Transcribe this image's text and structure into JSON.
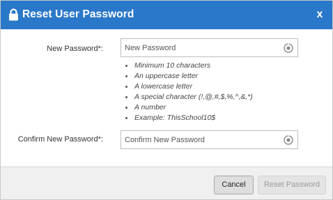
{
  "dialog": {
    "title": "Reset User Password",
    "close_label": "x",
    "header_color": "#2a78c9",
    "title_icon": "lock-icon"
  },
  "form": {
    "new_password": {
      "label": "New Password*:",
      "placeholder": "New Password",
      "value": "",
      "icon": "eye-icon"
    },
    "requirements": [
      "Minimum 10 characters",
      "An uppercase letter",
      "A lowercase letter",
      "A special character (!,@,#,$,%,^,&,*)",
      "A number",
      "Example: ThisSchool10$"
    ],
    "confirm_password": {
      "label": "Confirm New Password*:",
      "placeholder": "Confirm New Password",
      "value": "",
      "icon": "eye-icon"
    }
  },
  "footer": {
    "cancel_label": "Cancel",
    "reset_label": "Reset Password",
    "reset_disabled": true
  }
}
